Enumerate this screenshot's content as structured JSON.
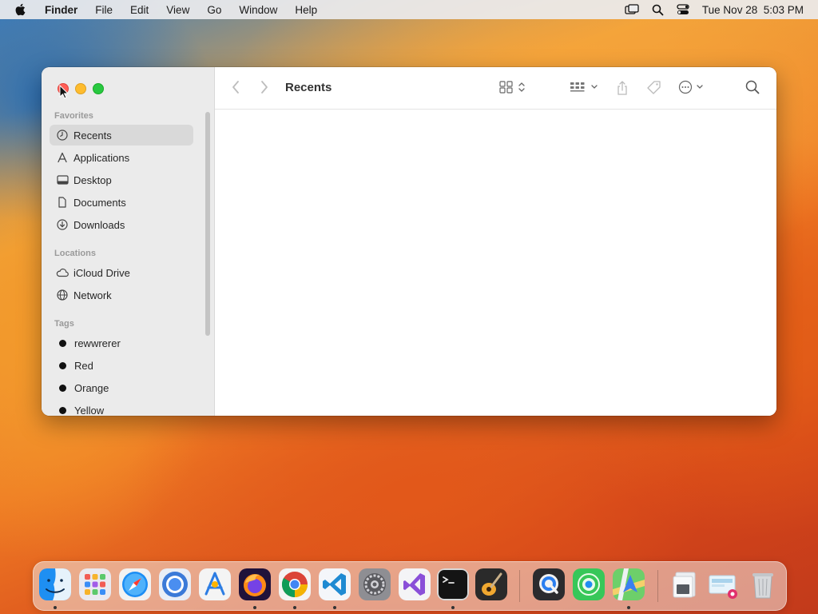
{
  "menubar": {
    "app_name": "Finder",
    "menus": [
      "File",
      "Edit",
      "View",
      "Go",
      "Window",
      "Help"
    ],
    "datetime": "Tue Nov 28  5:03 PM",
    "status_icons": [
      "screen-mirroring-icon",
      "spotlight-search-icon",
      "control-center-icon"
    ]
  },
  "window": {
    "title": "Recents",
    "sidebar": {
      "favorites_label": "Favorites",
      "favorites": [
        {
          "label": "Recents",
          "icon": "clock-icon",
          "selected": true
        },
        {
          "label": "Applications",
          "icon": "applications-icon"
        },
        {
          "label": "Desktop",
          "icon": "desktop-icon"
        },
        {
          "label": "Documents",
          "icon": "document-icon"
        },
        {
          "label": "Downloads",
          "icon": "download-icon"
        }
      ],
      "locations_label": "Locations",
      "locations": [
        {
          "label": "iCloud Drive",
          "icon": "cloud-icon"
        },
        {
          "label": "Network",
          "icon": "globe-icon"
        }
      ],
      "tags_label": "Tags",
      "tags": [
        {
          "label": "rewwrerer",
          "color": "#111111"
        },
        {
          "label": "Red",
          "color": "#111111"
        },
        {
          "label": "Orange",
          "color": "#111111"
        },
        {
          "label": "Yellow",
          "color": "#111111"
        }
      ]
    },
    "toolbar_icons": [
      "back-icon",
      "forward-icon",
      "icon-view-icon",
      "group-icon",
      "share-icon",
      "tag-icon",
      "more-actions-icon",
      "search-icon"
    ]
  },
  "dock": {
    "apps": [
      {
        "name": "Finder",
        "running": true
      },
      {
        "name": "Launchpad",
        "running": false
      },
      {
        "name": "Safari",
        "running": false
      },
      {
        "name": "Chromium",
        "running": false
      },
      {
        "name": "Xcode Instruments",
        "running": false
      },
      {
        "name": "Firefox",
        "running": true
      },
      {
        "name": "Google Chrome",
        "running": true
      },
      {
        "name": "Visual Studio Code",
        "running": true
      },
      {
        "name": "System Settings",
        "running": false
      },
      {
        "name": "Visual Studio",
        "running": false
      },
      {
        "name": "Terminal",
        "running": true
      },
      {
        "name": "GarageBand",
        "running": false
      },
      {
        "name": "QuickTime Player",
        "running": false
      },
      {
        "name": "Find My",
        "running": false
      },
      {
        "name": "Maps",
        "running": true
      }
    ],
    "extras": [
      "Downloads Stack",
      "Screenshot Stack",
      "Trash"
    ]
  }
}
